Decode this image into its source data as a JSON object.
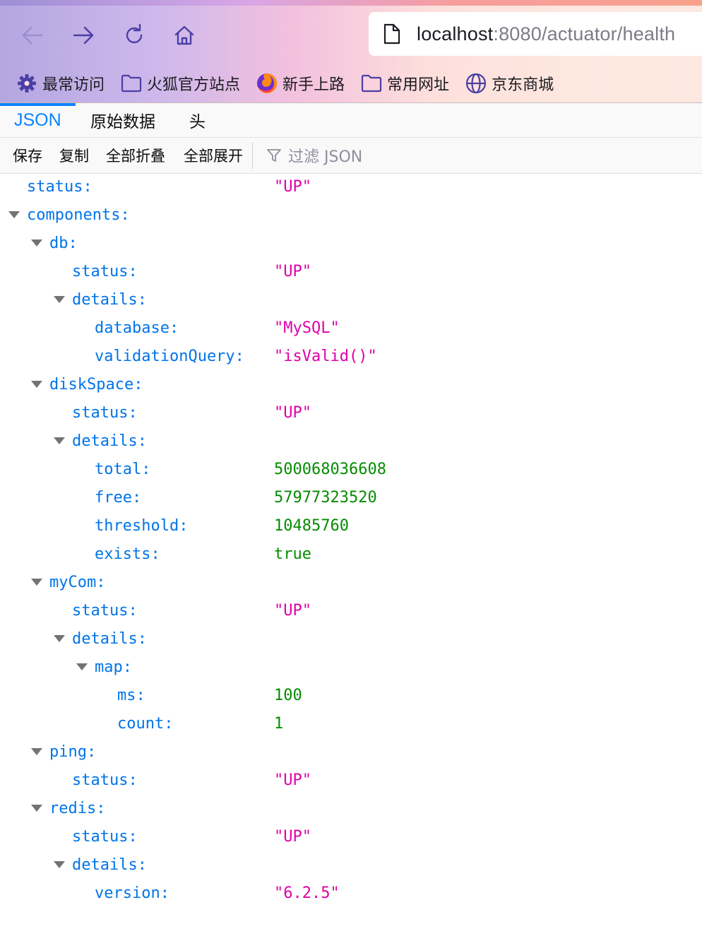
{
  "browser": {
    "url_host": "localhost",
    "url_path": ":8080/actuator/health",
    "bookmarks": [
      {
        "label": "最常访问",
        "icon": "gear-icon"
      },
      {
        "label": "火狐官方站点",
        "icon": "folder-icon"
      },
      {
        "label": "新手上路",
        "icon": "firefox-icon"
      },
      {
        "label": "常用网址",
        "icon": "folder-icon"
      },
      {
        "label": "京东商城",
        "icon": "globe-icon"
      }
    ]
  },
  "viewer": {
    "tabs": [
      {
        "label": "JSON",
        "selected": true
      },
      {
        "label": "原始数据",
        "selected": false
      },
      {
        "label": "头",
        "selected": false
      }
    ],
    "toolbar": {
      "save": "保存",
      "copy": "复制",
      "collapse_all": "全部折叠",
      "expand_all": "全部展开",
      "filter_placeholder": "过滤 JSON"
    }
  },
  "json_tree": [
    {
      "key": "status:",
      "value": "\"UP\"",
      "type": "str",
      "depth": 0,
      "expandable": false
    },
    {
      "key": "components:",
      "value": "",
      "type": "obj",
      "depth": 0,
      "expandable": true
    },
    {
      "key": "db:",
      "value": "",
      "type": "obj",
      "depth": 1,
      "expandable": true
    },
    {
      "key": "status:",
      "value": "\"UP\"",
      "type": "str",
      "depth": 2,
      "expandable": false
    },
    {
      "key": "details:",
      "value": "",
      "type": "obj",
      "depth": 2,
      "expandable": true
    },
    {
      "key": "database:",
      "value": "\"MySQL\"",
      "type": "str",
      "depth": 3,
      "expandable": false
    },
    {
      "key": "validationQuery:",
      "value": "\"isValid()\"",
      "type": "str",
      "depth": 3,
      "expandable": false
    },
    {
      "key": "diskSpace:",
      "value": "",
      "type": "obj",
      "depth": 1,
      "expandable": true
    },
    {
      "key": "status:",
      "value": "\"UP\"",
      "type": "str",
      "depth": 2,
      "expandable": false
    },
    {
      "key": "details:",
      "value": "",
      "type": "obj",
      "depth": 2,
      "expandable": true
    },
    {
      "key": "total:",
      "value": "500068036608",
      "type": "num",
      "depth": 3,
      "expandable": false
    },
    {
      "key": "free:",
      "value": "57977323520",
      "type": "num",
      "depth": 3,
      "expandable": false
    },
    {
      "key": "threshold:",
      "value": "10485760",
      "type": "num",
      "depth": 3,
      "expandable": false
    },
    {
      "key": "exists:",
      "value": "true",
      "type": "bool",
      "depth": 3,
      "expandable": false
    },
    {
      "key": "myCom:",
      "value": "",
      "type": "obj",
      "depth": 1,
      "expandable": true
    },
    {
      "key": "status:",
      "value": "\"UP\"",
      "type": "str",
      "depth": 2,
      "expandable": false
    },
    {
      "key": "details:",
      "value": "",
      "type": "obj",
      "depth": 2,
      "expandable": true
    },
    {
      "key": "map:",
      "value": "",
      "type": "obj",
      "depth": 3,
      "expandable": true
    },
    {
      "key": "ms:",
      "value": "100",
      "type": "num",
      "depth": 4,
      "expandable": false
    },
    {
      "key": "count:",
      "value": "1",
      "type": "num",
      "depth": 4,
      "expandable": false
    },
    {
      "key": "ping:",
      "value": "",
      "type": "obj",
      "depth": 1,
      "expandable": true
    },
    {
      "key": "status:",
      "value": "\"UP\"",
      "type": "str",
      "depth": 2,
      "expandable": false
    },
    {
      "key": "redis:",
      "value": "",
      "type": "obj",
      "depth": 1,
      "expandable": true
    },
    {
      "key": "status:",
      "value": "\"UP\"",
      "type": "str",
      "depth": 2,
      "expandable": false
    },
    {
      "key": "details:",
      "value": "",
      "type": "obj",
      "depth": 2,
      "expandable": true
    },
    {
      "key": "version:",
      "value": "\"6.2.5\"",
      "type": "str",
      "depth": 3,
      "expandable": false
    }
  ]
}
